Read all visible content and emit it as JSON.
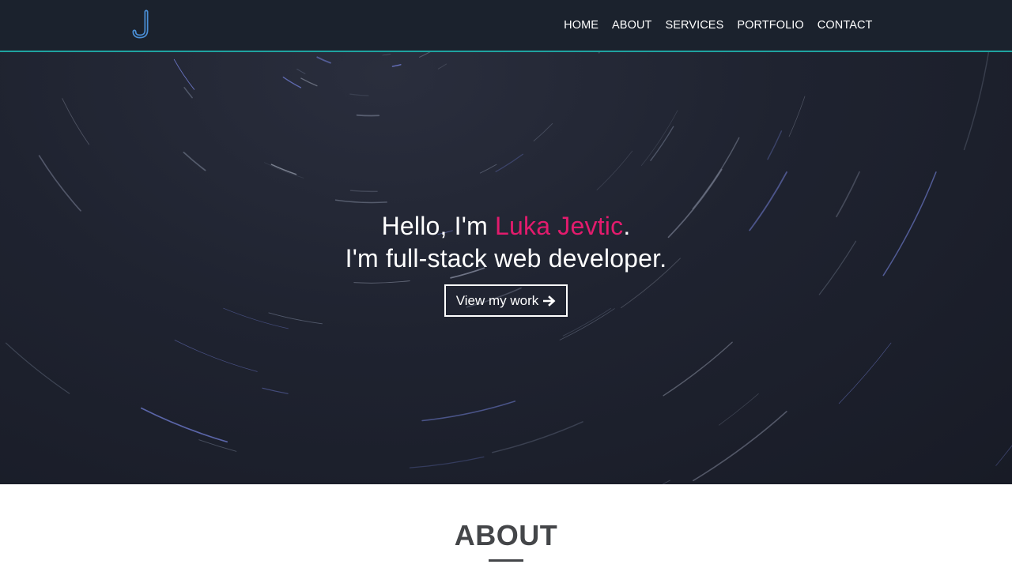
{
  "brand": {
    "logo_letter": "J",
    "accent_teal": "#1fa3a0",
    "accent_pink": "#e31b6d",
    "logo_color": "#4a8fd6"
  },
  "nav": {
    "items": [
      {
        "label": "HOME"
      },
      {
        "label": "ABOUT"
      },
      {
        "label": "SERVICES"
      },
      {
        "label": "PORTFOLIO"
      },
      {
        "label": "CONTACT"
      }
    ]
  },
  "hero": {
    "greeting_prefix": "Hello, I'm ",
    "name": "Luka Jevtic",
    "greeting_suffix": ".",
    "tagline": "I'm full-stack web developer.",
    "cta_label": "View my work",
    "cta_icon": "arrow-right-icon",
    "background": "star-trails"
  },
  "about": {
    "title": "ABOUT"
  }
}
